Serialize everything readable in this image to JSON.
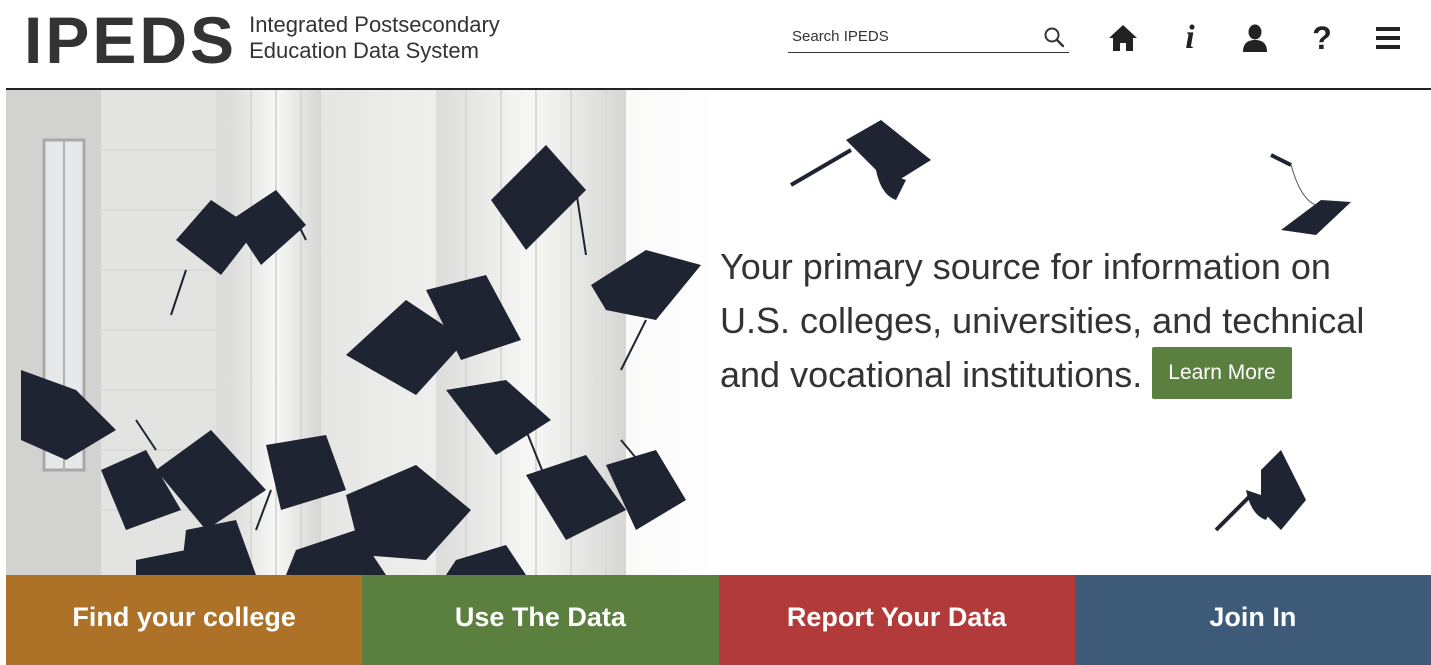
{
  "logo": {
    "mark": "IPEDS",
    "line1": "Integrated Postsecondary",
    "line2": "Education Data System"
  },
  "search": {
    "placeholder": "Search IPEDS",
    "icon": "search-icon"
  },
  "nav": {
    "icons": [
      "home-icon",
      "info-icon",
      "user-icon",
      "help-icon",
      "menu-icon"
    ],
    "info_glyph": "i",
    "help_glyph": "?"
  },
  "hero": {
    "line1": "Your primary source for information on",
    "line2": "U.S. colleges, universities, and technical",
    "line3": "and vocational institutions.",
    "cta": "Learn More"
  },
  "tiles": [
    {
      "label": "Find your college",
      "color": "#ad7227"
    },
    {
      "label": "Use The Data",
      "color": "#5b7f3e"
    },
    {
      "label": "Report Your Data",
      "color": "#b23a3a"
    },
    {
      "label": "Join In",
      "color": "#3d5b78"
    }
  ],
  "colors": {
    "accent_green": "#5a7f3e",
    "text": "#333333"
  }
}
